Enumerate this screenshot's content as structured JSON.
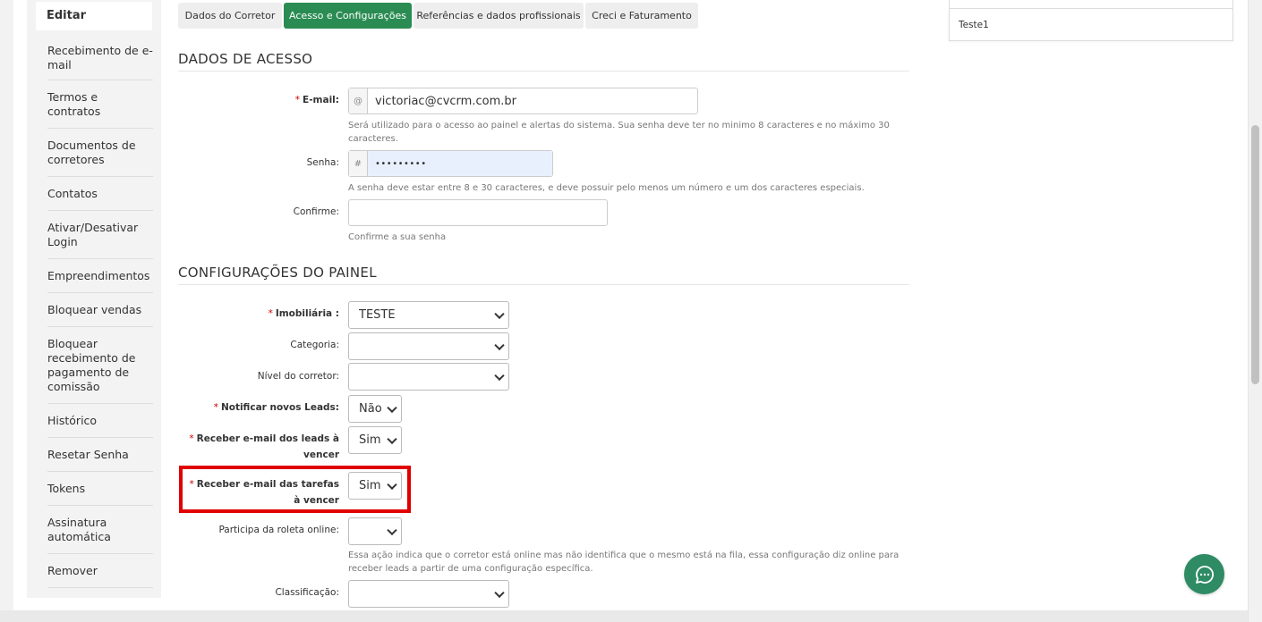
{
  "sidebar": {
    "title": "Editar",
    "items": [
      {
        "label": "Recebimento de e-mail"
      },
      {
        "label": "Termos e contratos"
      },
      {
        "label": "Documentos de corretores"
      },
      {
        "label": "Contatos"
      },
      {
        "label": "Ativar/Desativar Login"
      },
      {
        "label": "Empreendimentos"
      },
      {
        "label": "Bloquear vendas"
      },
      {
        "label": "Bloquear recebimento de pagamento de comissão"
      },
      {
        "label": "Histórico"
      },
      {
        "label": "Resetar Senha"
      },
      {
        "label": "Tokens"
      },
      {
        "label": "Assinatura automática"
      },
      {
        "label": "Remover"
      }
    ]
  },
  "tabs": [
    {
      "label": "Dados do Corretor"
    },
    {
      "label": "Acesso e Configurações"
    },
    {
      "label": "Referências e dados profissionais"
    },
    {
      "label": "Creci e Faturamento"
    }
  ],
  "access": {
    "title": "DADOS DE ACESSO",
    "email_label": "E-mail:",
    "email_addon": "@",
    "email_value": "victoriac@cvcrm.com.br",
    "email_help": "Será utilizado para o acesso ao painel e alertas do sistema. Sua senha deve ter no minimo 8 caracteres e no máximo 30 caracteres.",
    "password_label": "Senha:",
    "password_addon": "#",
    "password_value": "•••••••••",
    "password_help": "A senha deve estar entre 8 e 30 caracteres, e deve possuir pelo menos um número e um dos caracteres especiais.",
    "confirm_label": "Confirme:",
    "confirm_value": "",
    "confirm_help": "Confirme a sua senha"
  },
  "panel": {
    "title": "CONFIGURAÇÕES DO PAINEL",
    "imobiliaria_label": "Imobiliária :",
    "imobiliaria_value": "TESTE",
    "categoria_label": "Categoria:",
    "categoria_value": "",
    "nivel_label": "Nível do corretor:",
    "nivel_value": "",
    "notificar_label": "Notificar novos Leads:",
    "notificar_value": "Não",
    "leads_vencer_label": "Receber e-mail dos leads à vencer",
    "leads_vencer_value": "Sim",
    "tarefas_vencer_label": "Receber e-mail das tarefas à vencer",
    "tarefas_vencer_value": "Sim",
    "roleta_label": "Participa da roleta online:",
    "roleta_value": "",
    "roleta_help": "Essa ação indica que o corretor está online mas não identifica que o mesmo está na fila, essa configuração diz online para receber leads a partir de uma configuração específica.",
    "classificacao_label": "Classificação:",
    "classificacao_value": ""
  },
  "right_panel": {
    "row_label": "Teste1"
  },
  "colors": {
    "accent": "#2a8c52",
    "highlight": "#e00000",
    "chat": "#2e8b63"
  }
}
